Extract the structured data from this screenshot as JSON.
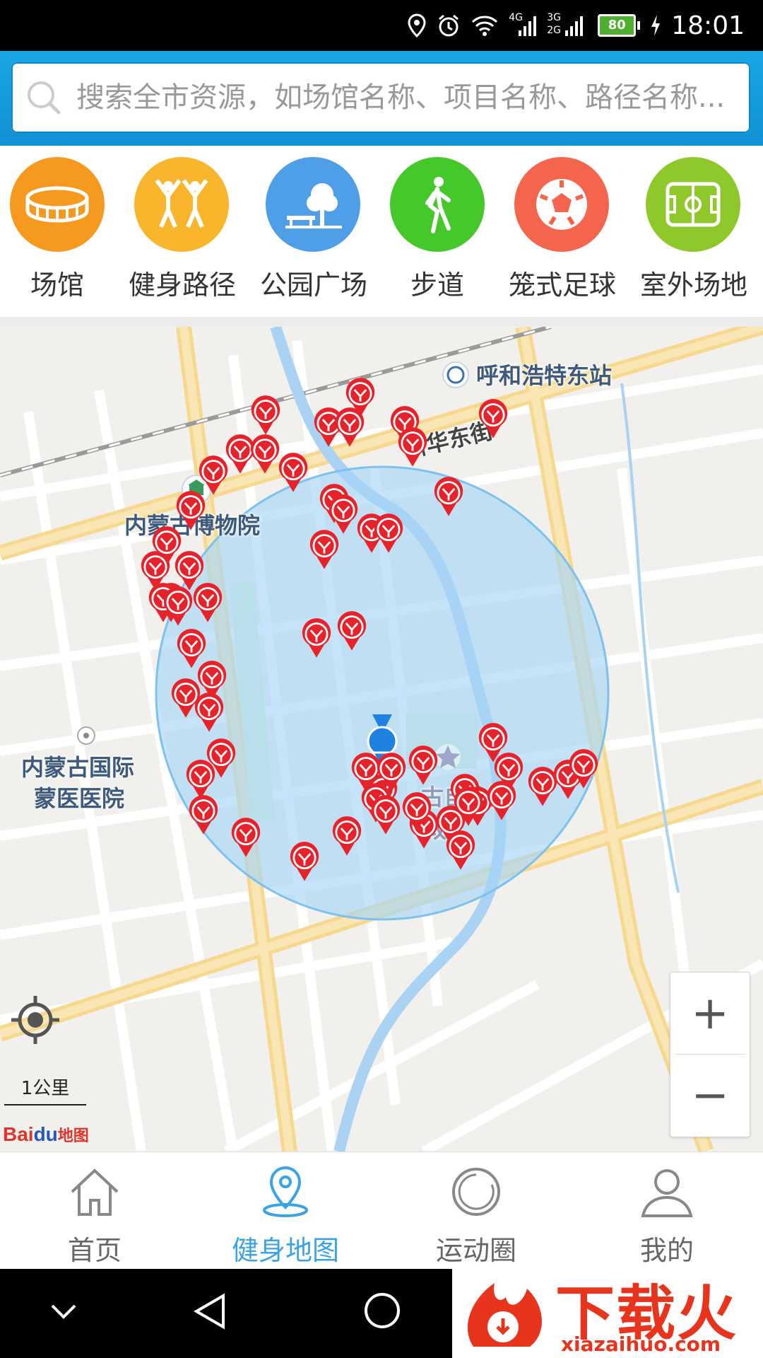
{
  "status_bar": {
    "time": "18:01",
    "battery": "80",
    "network_a": "4G",
    "network_b1": "3G",
    "network_b2": "2G"
  },
  "search": {
    "placeholder": "搜索全市资源，如场馆名称、项目名称、路径名称..."
  },
  "categories": [
    {
      "label": "场馆",
      "color": "#f59a1f",
      "icon": "stadium-icon"
    },
    {
      "label": "健身路径",
      "color": "#f9b52c",
      "icon": "fitness-path-icon"
    },
    {
      "label": "公园广场",
      "color": "#4f9ee8",
      "icon": "park-icon"
    },
    {
      "label": "步道",
      "color": "#45c82a",
      "icon": "walking-icon"
    },
    {
      "label": "笼式足球",
      "color": "#f5644c",
      "icon": "soccer-icon"
    },
    {
      "label": "室外场地",
      "color": "#8fc82a",
      "icon": "outdoor-field-icon"
    }
  ],
  "map": {
    "labels": {
      "station": "呼和浩特东站",
      "street": "新华东街",
      "museum": "内蒙古博物院",
      "hospital_line1": "内蒙古国际",
      "hospital_line2": "蒙医医院",
      "gov_line1": "古自治区",
      "gov_line2": "政"
    },
    "scale": "1公里",
    "logo_a": "Bai",
    "logo_b": "du",
    "logo_c": "地图",
    "zoom_in": "+",
    "zoom_out": "−"
  },
  "tabs": [
    {
      "label": "首页",
      "icon": "home-icon"
    },
    {
      "label": "健身地图",
      "icon": "map-pin-icon",
      "active": true
    },
    {
      "label": "运动圈",
      "icon": "circle-icon"
    },
    {
      "label": "我的",
      "icon": "user-icon"
    }
  ],
  "watermark": {
    "title": "下载火",
    "url": "xiazaihuo.com"
  },
  "colors": {
    "accent": "#3aa3e3",
    "pin": "#e8222b",
    "header": "#1aa2e3"
  }
}
